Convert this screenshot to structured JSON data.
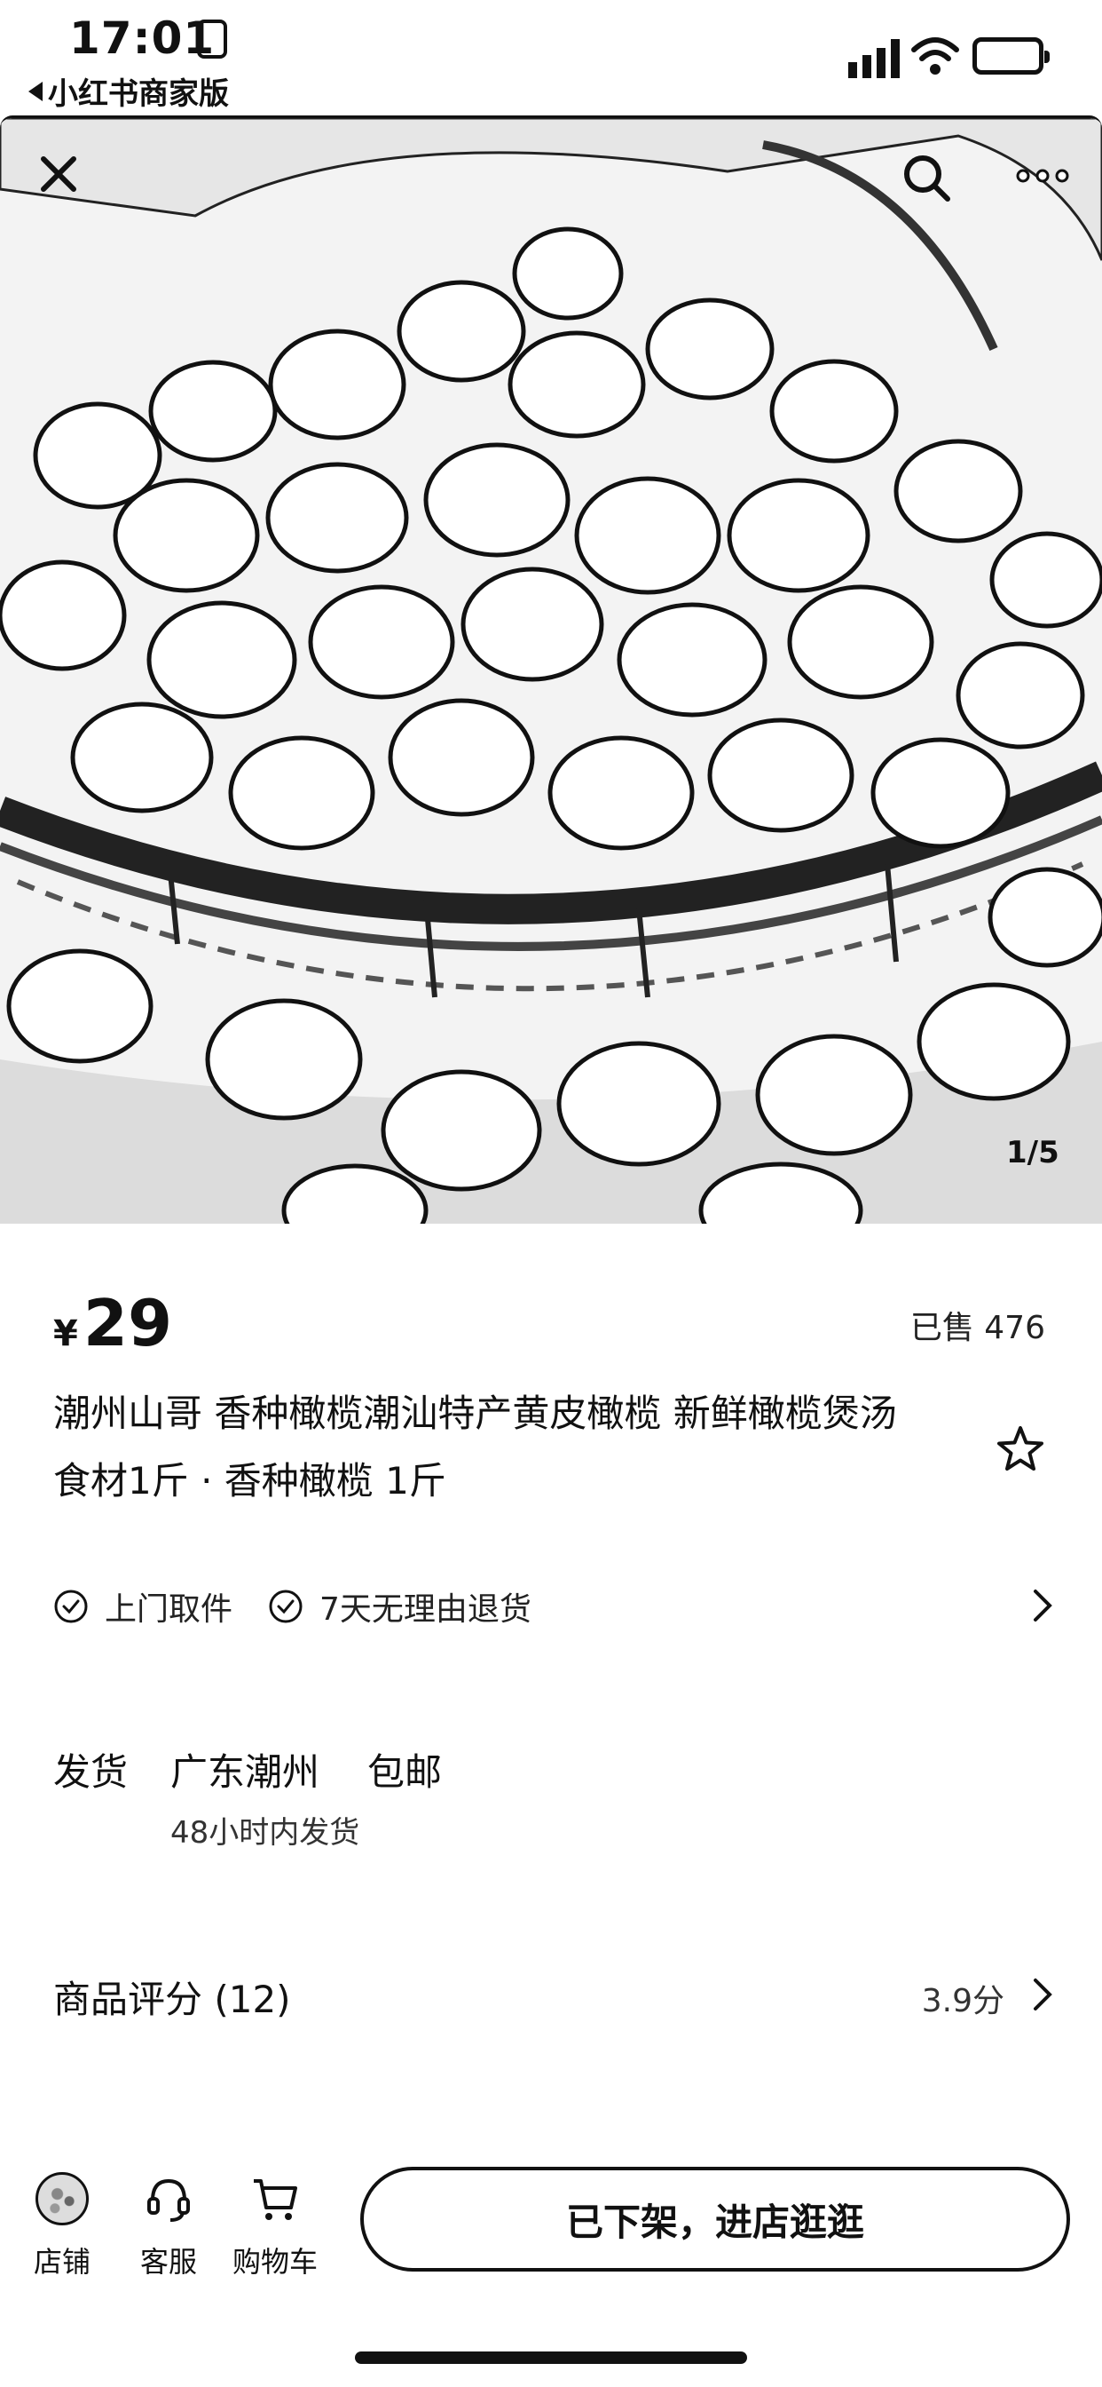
{
  "status_bar": {
    "time": "17:01",
    "back_app": "小红书商家版",
    "icons": [
      "cellular-signal-icon",
      "wifi-icon",
      "battery-icon"
    ]
  },
  "gallery": {
    "counter": "1/5",
    "current": 1,
    "total": 5,
    "image_description_icon": "olives-in-basket-photo",
    "buttons": [
      "close-icon",
      "search-icon",
      "more-icon"
    ]
  },
  "product": {
    "currency": "¥",
    "price": "29",
    "sold": "已售 476",
    "title": "潮州山哥 香种橄榄潮汕特产黄皮橄榄 新鲜橄榄煲汤食材1斤 · 香种橄榄 1斤",
    "favorite_icon": "star-outline-icon"
  },
  "services": {
    "items": [
      {
        "label": "上门取件",
        "icon": "check-circle-icon"
      },
      {
        "label": "7天无理由退货",
        "icon": "check-circle-icon"
      }
    ]
  },
  "shipping": {
    "label": "发货",
    "from": "广东潮州",
    "fee": "包邮",
    "time": "48小时内发货"
  },
  "rating": {
    "title": "商品评分 (12)",
    "score": "3.9分"
  },
  "bottom_bar": {
    "store_label": "店铺",
    "service_label": "客服",
    "cart_label": "购物车",
    "action_label": "已下架，进店逛逛"
  },
  "colors": {
    "text": "#111111",
    "background": "#ffffff"
  }
}
